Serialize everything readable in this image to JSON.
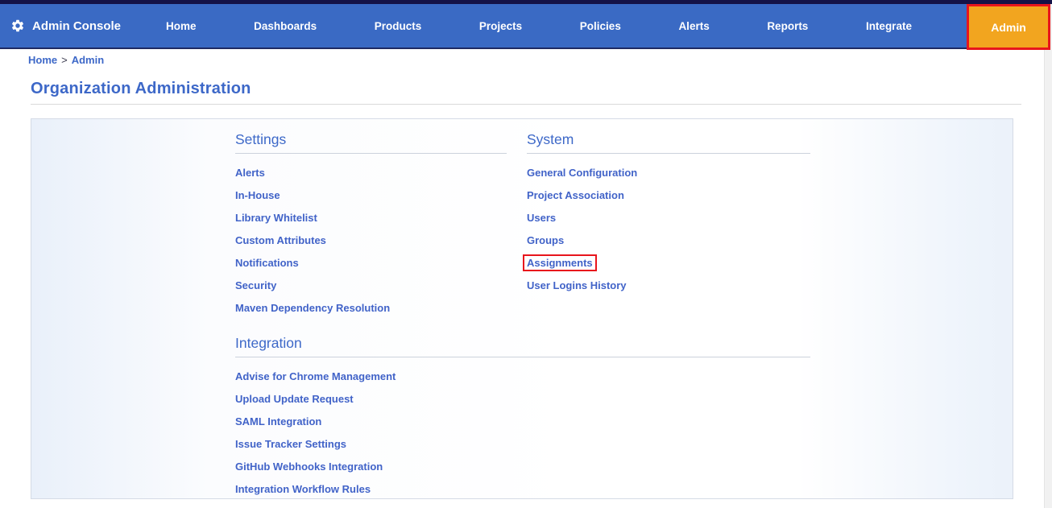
{
  "brand": {
    "label": "Admin Console"
  },
  "nav": {
    "items": [
      "Home",
      "Dashboards",
      "Products",
      "Projects",
      "Policies",
      "Alerts",
      "Reports",
      "Integrate"
    ],
    "admin_label": "Admin"
  },
  "breadcrumb": {
    "home": "Home",
    "separator": ">",
    "current": "Admin"
  },
  "page": {
    "title": "Organization Administration"
  },
  "sections": {
    "settings": {
      "title": "Settings",
      "links": [
        "Alerts",
        "In-House",
        "Library Whitelist",
        "Custom Attributes",
        "Notifications",
        "Security",
        "Maven Dependency Resolution"
      ]
    },
    "system": {
      "title": "System",
      "links": [
        "General Configuration",
        "Project Association",
        "Users",
        "Groups",
        "Assignments",
        "User Logins History"
      ],
      "annotated_link": "Assignments"
    },
    "integration": {
      "title": "Integration",
      "links": [
        "Advise for Chrome Management",
        "Upload Update Request",
        "SAML Integration",
        "Issue Tracker Settings",
        "GitHub Webhooks Integration",
        "Integration Workflow Rules"
      ]
    }
  },
  "colors": {
    "top_strip": "#141247",
    "nav_bar": "#3a6ac4",
    "admin_button_orange": "#f2a51f",
    "annotation_red": "#e8151c",
    "link_blue": "#4163c8",
    "heading_blue": "#3d68c8"
  }
}
